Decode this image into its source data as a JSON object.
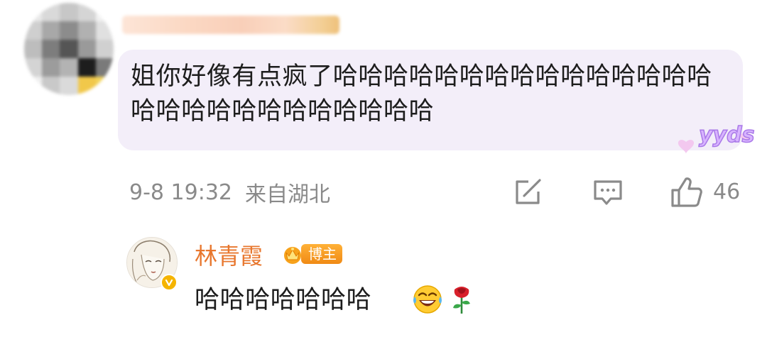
{
  "comment": {
    "text": "姐你好像有点疯了哈哈哈哈哈哈哈哈哈哈哈哈哈哈哈哈哈哈哈哈哈哈哈哈哈哈哈",
    "sticker": "yyds",
    "time": "9-8 19:32",
    "location": "来自湖北",
    "like_count": "46"
  },
  "reply": {
    "name": "林青霞",
    "badge": "博主",
    "text": "哈哈哈哈哈哈哈",
    "emojis": [
      "laugh-cry-emoji",
      "rose-emoji"
    ]
  },
  "colors": {
    "bubble": "#f3eef9",
    "meta_gray": "#8a8a8a",
    "name_orange": "#e8772e",
    "badge_orange": "#f08a15"
  }
}
